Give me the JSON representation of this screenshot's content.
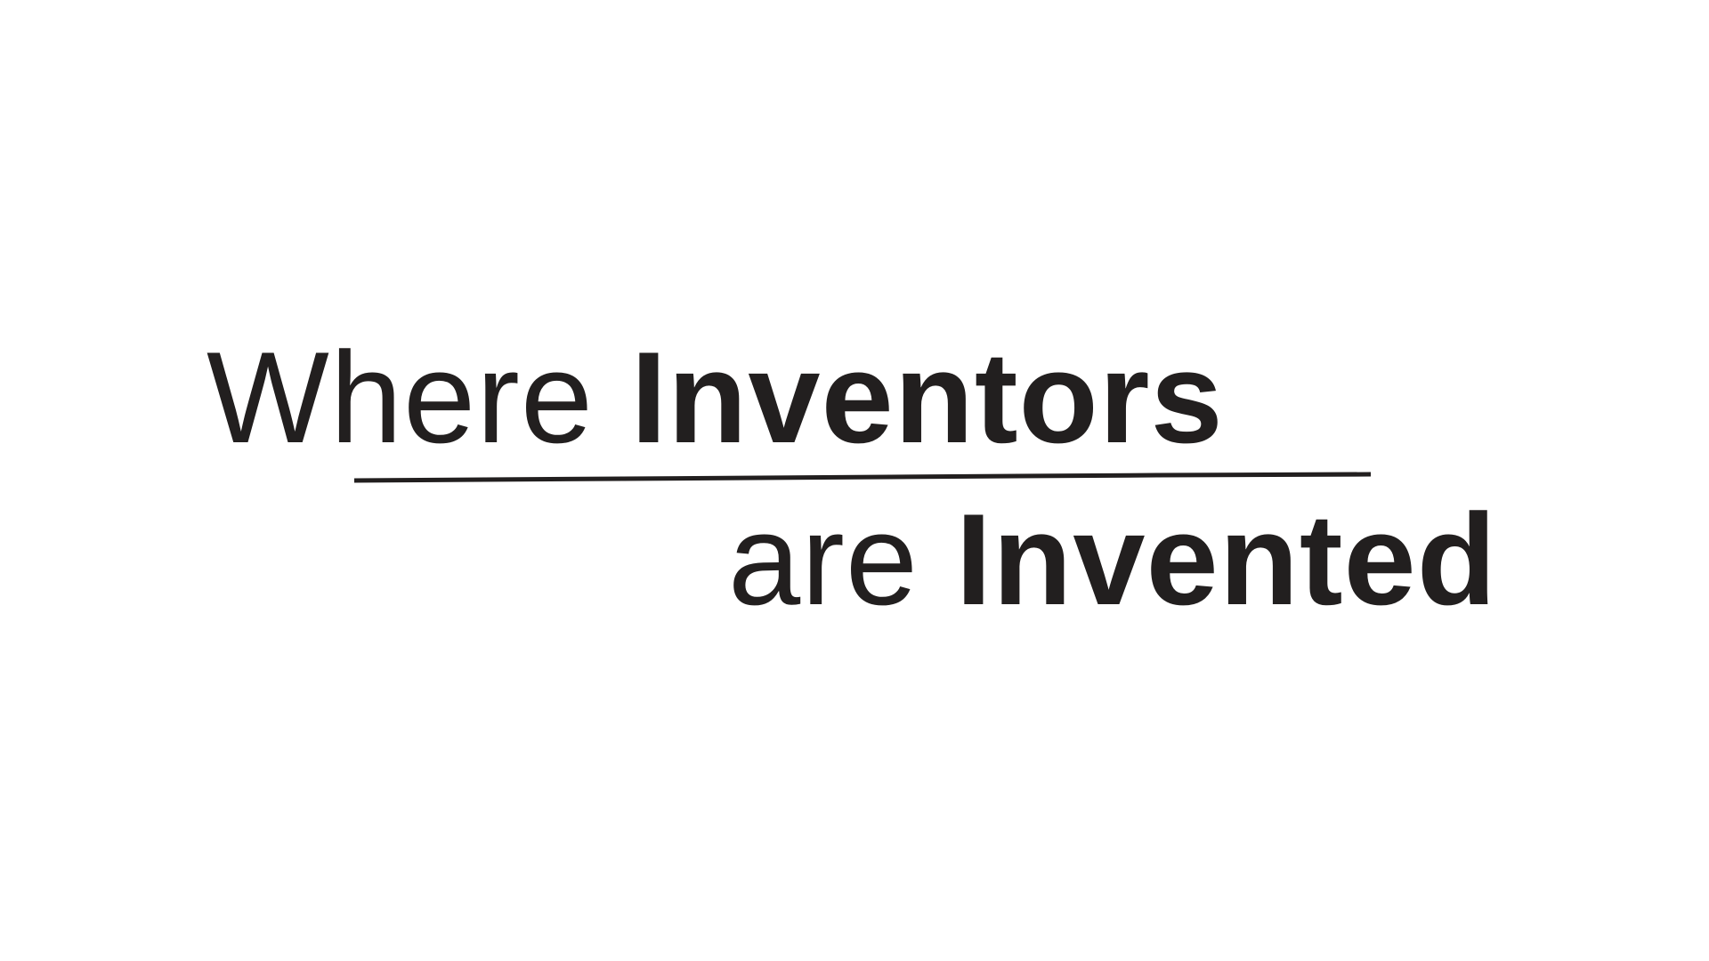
{
  "headline": {
    "line_1": {
      "regular": "Where",
      "bold": "Inventors"
    },
    "line_2": {
      "regular": "are",
      "bold": "Invented"
    }
  },
  "colors": {
    "text": "#221f1f",
    "background": "#ffffff"
  }
}
